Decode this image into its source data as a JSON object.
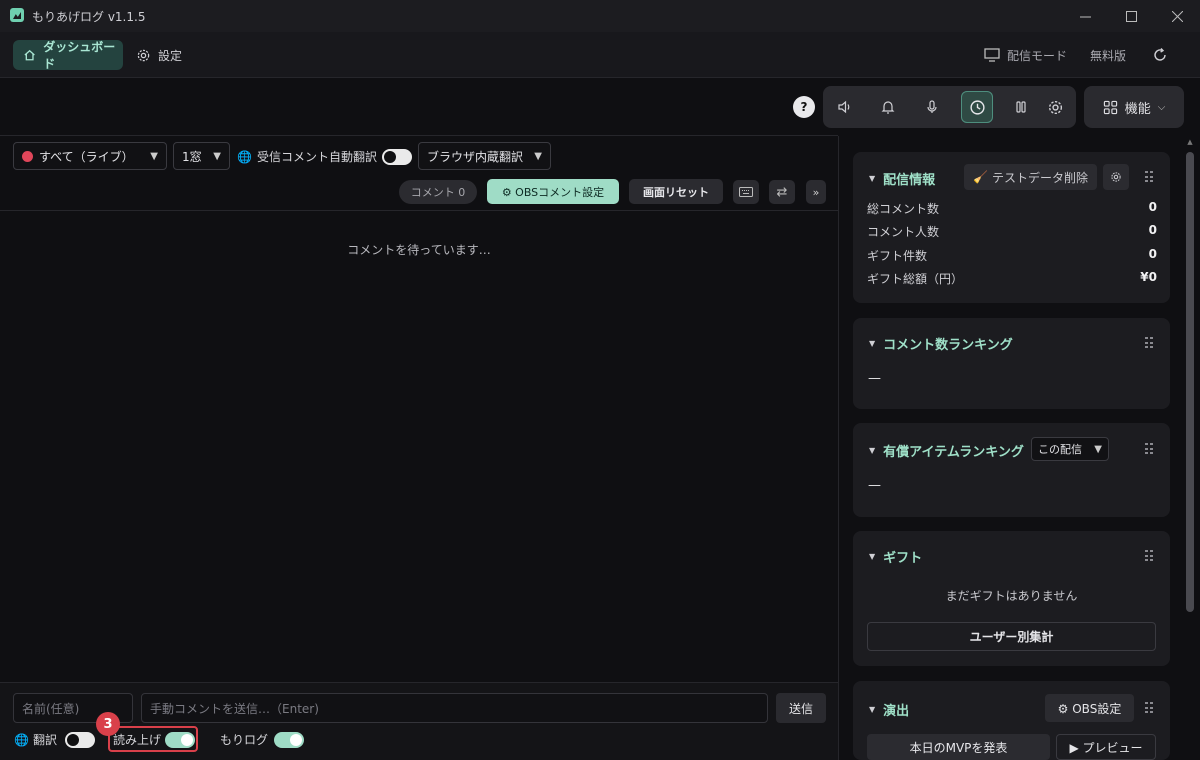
{
  "window": {
    "title": "もりあげログ v1.1.5",
    "controls": [
      "minimize",
      "maximize",
      "close"
    ]
  },
  "nav": {
    "dashboard_label": "ダッシュボード",
    "settings_label": "設定",
    "broadcast_mode_label": "配信モード",
    "free_version_label": "無料版"
  },
  "toolbar": {
    "help_label": "?",
    "feature_label": "機能",
    "icons": [
      "speaker-icon",
      "bell-icon",
      "mic-icon",
      "clock-icon",
      "columns-icon",
      "gear-icon"
    ],
    "active_icon": "clock-icon"
  },
  "filters": {
    "source_select": "すべて（ライブ）",
    "window_select": "1窓",
    "auto_translate_label": "受信コメント自動翻訳",
    "auto_translate_on": false,
    "translate_engine_select": "ブラウザ内蔵翻訳"
  },
  "comment_controls": {
    "comment_count_label": "コメント 0",
    "obs_comment_settings_label": "⚙ OBSコメント設定",
    "screen_reset_label": "画面リセット",
    "more_label": "»"
  },
  "comments": {
    "empty_message": "コメントを待っています…"
  },
  "composer": {
    "name_placeholder": "名前(任意)",
    "comment_placeholder": "手動コメントを送信…（Enter)",
    "send_label": "送信",
    "translate_label": "翻訳",
    "translate_on": false,
    "read_aloud_label": "読み上げ",
    "read_aloud_on": true,
    "morilog_label": "もりログ",
    "morilog_on": true,
    "step_badge": "3"
  },
  "broadcast_info": {
    "title": "配信情報",
    "delete_test_data_label": "テストデータ削除",
    "stats": [
      {
        "label": "総コメント数",
        "value": "0"
      },
      {
        "label": "コメント人数",
        "value": "0"
      },
      {
        "label": "ギフト件数",
        "value": "0"
      },
      {
        "label": "ギフト総額（円）",
        "value": "¥0"
      }
    ]
  },
  "comment_ranking": {
    "title": "コメント数ランキング",
    "empty": "—"
  },
  "paid_ranking": {
    "title": "有償アイテムランキング",
    "scope_select": "この配信",
    "empty": "—"
  },
  "gifts": {
    "title": "ギフト",
    "empty_message": "まだギフトはありません",
    "per_user_label": "ユーザー別集計"
  },
  "effects": {
    "title": "演出",
    "obs_settings_label": "⚙ OBS設定",
    "announce_mvp_label": "本日のMVPを発表",
    "preview_label": "▶ プレビュー"
  },
  "colors": {
    "accent": "#9fdcc6",
    "alert_red": "#d9404a",
    "background": "#0f0f12"
  }
}
